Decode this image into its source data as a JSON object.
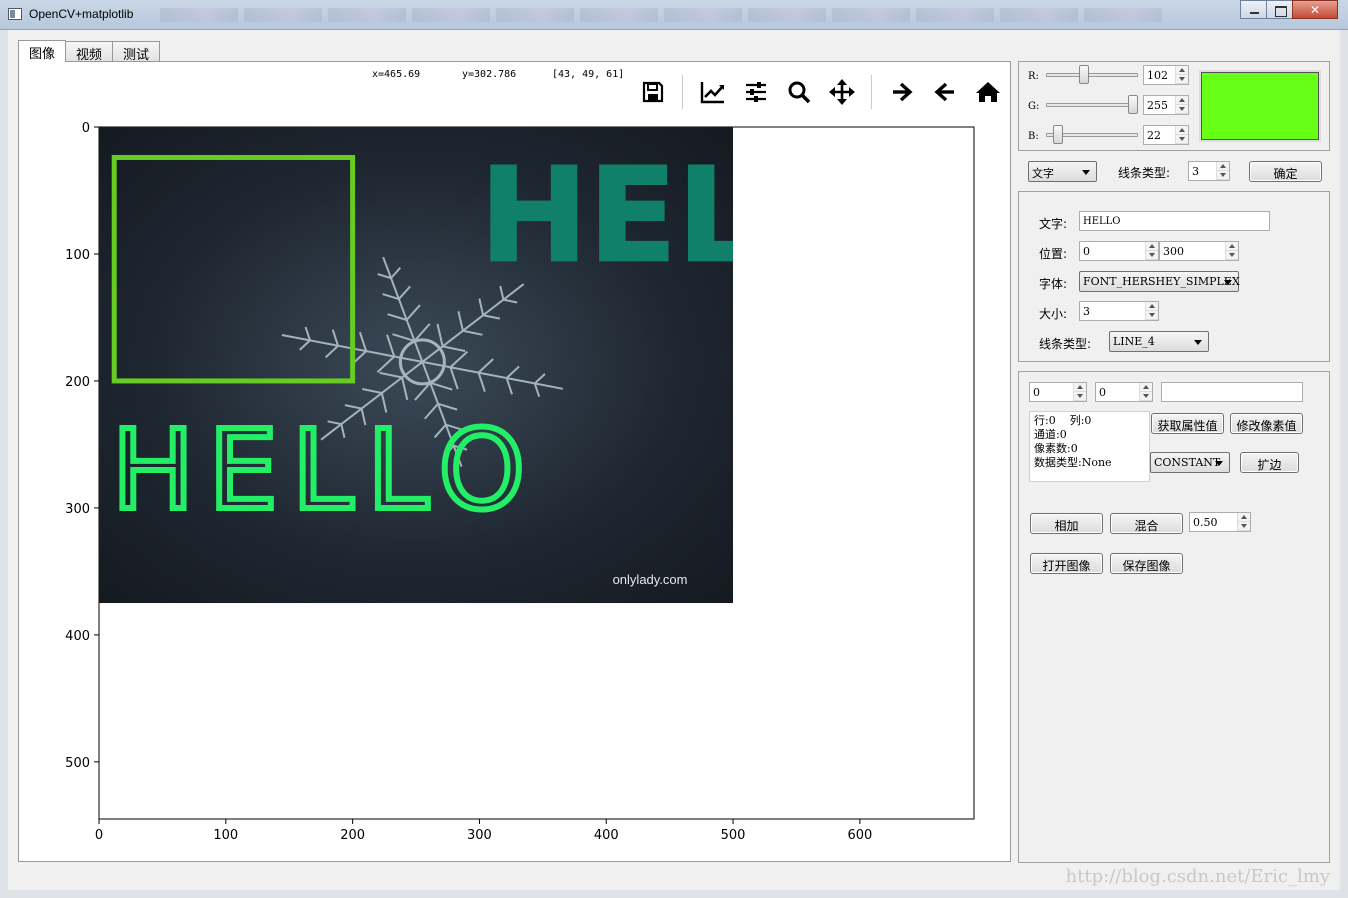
{
  "window": {
    "title": "OpenCV+matplotlib"
  },
  "tabs": [
    {
      "label": "图像"
    },
    {
      "label": "视频"
    },
    {
      "label": "测试"
    }
  ],
  "figure": {
    "coord_x": "x=465.69",
    "coord_y": "y=302.786",
    "pixel_value": "[43, 49, 61]",
    "toolbar_icons": [
      "save-icon",
      "line-chart-icon",
      "sliders-icon",
      "zoom-icon",
      "pan-icon",
      "forward-arrow-icon",
      "back-arrow-icon",
      "home-icon"
    ]
  },
  "chart_data": {
    "type": "image",
    "xlim": [
      0,
      690
    ],
    "ylim": [
      545,
      0
    ],
    "x_ticks": [
      "0",
      "100",
      "200",
      "300",
      "400",
      "500",
      "600"
    ],
    "y_ticks": [
      "0",
      "100",
      "200",
      "300",
      "400",
      "500"
    ],
    "image_extent": {
      "x": [
        0,
        500
      ],
      "y": [
        0,
        375
      ]
    },
    "overlays": [
      {
        "kind": "rectangle",
        "x0": 12,
        "y0": 24,
        "x1": 200,
        "y1": 200,
        "color": "#66cc22"
      },
      {
        "kind": "text",
        "text": "HELLO",
        "x": 10,
        "y": 300,
        "color": "#22ee66"
      },
      {
        "kind": "text",
        "text": "HELL",
        "x": 300,
        "y": 105,
        "color": "#11806b"
      }
    ],
    "watermark": "onlylady.com"
  },
  "rgb": {
    "r_label": "R:",
    "r_value": "102",
    "g_label": "G:",
    "g_value": "255",
    "b_label": "B:",
    "b_value": "22",
    "r_frac": 0.4,
    "g_frac": 1.0,
    "b_frac": 0.086,
    "preview_color": "#66ff16"
  },
  "draw_row": {
    "shape": "文字",
    "line_type_label": "线条类型:",
    "line_type_value": "3",
    "ok": "确定"
  },
  "text_group": {
    "text_label": "文字:",
    "text_value": "HELLO",
    "pos_label": "位置:",
    "pos_x": "0",
    "pos_y": "300",
    "font_label": "字体:",
    "font_value": "FONT_HERSHEY_SIMPLEX",
    "size_label": "大小:",
    "size_value": "3",
    "line_label": "线条类型:",
    "line_value": "LINE_4"
  },
  "pixel_group": {
    "row_spin": "0",
    "col_spin": "0",
    "value_field": "",
    "info_row": "行:0",
    "info_col": "列:0",
    "info_channels": "通道:0",
    "info_pixels": "像素数:0",
    "info_dtype": "数据类型:None",
    "get_props": "获取属性值",
    "set_pixel": "修改像素值",
    "border_type": "CONSTANT",
    "border_btn": "扩边",
    "add_btn": "相加",
    "blend_btn": "混合",
    "blend_value": "0.50",
    "open_btn": "打开图像",
    "save_btn": "保存图像"
  },
  "watermark": "http://blog.csdn.net/Eric_lmy"
}
